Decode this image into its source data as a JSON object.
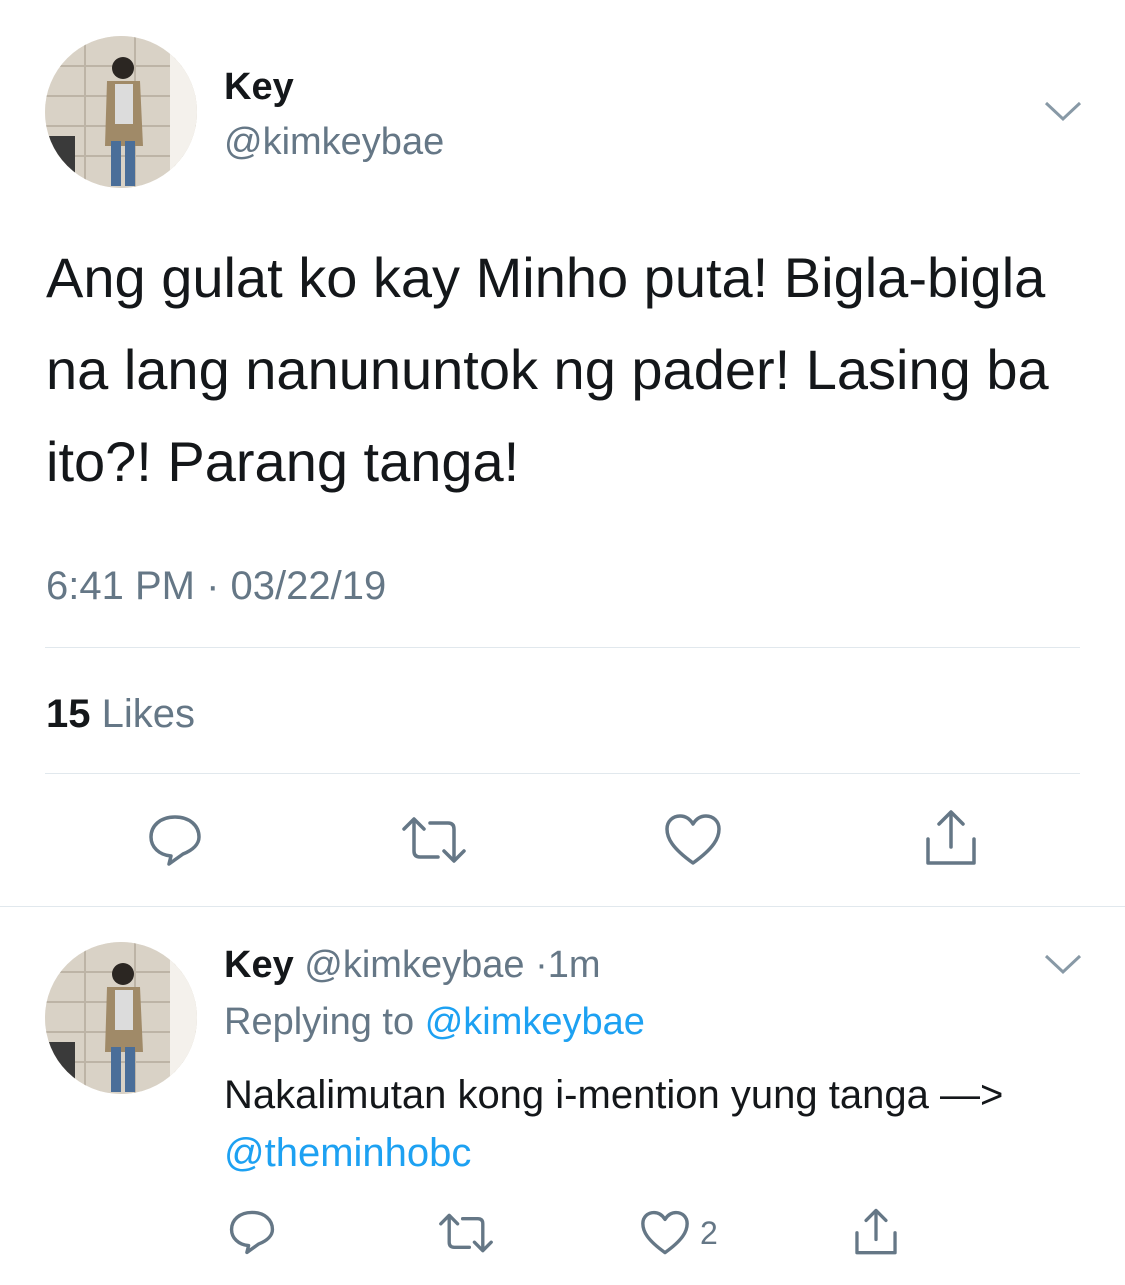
{
  "tweet": {
    "author_name": "Key",
    "author_handle": "@kimkeybae",
    "text": "Ang gulat ko kay Minho puta! Bigla-bigla na lang nanununtok ng pader! Lasing ba ito?! Parang tanga!",
    "timestamp": "6:41 PM · 03/22/19",
    "likes_count": "15",
    "likes_label": "Likes"
  },
  "reply": {
    "author_name": "Key",
    "author_handle": "@kimkeybae",
    "time_sep": "·",
    "time": "1m",
    "replying_label": "Replying to",
    "replying_handle": "@kimkeybae",
    "text": "Nakalimutan kong i-mention yung tanga —>",
    "mention": "@theminhobc",
    "like_count": "2"
  },
  "colors": {
    "text": "#14171a",
    "secondary": "#657786",
    "link": "#1da1f2",
    "divider": "#e1e8ed"
  },
  "icons": [
    "chevron-down-icon",
    "reply-icon",
    "retweet-icon",
    "heart-icon",
    "share-icon"
  ]
}
